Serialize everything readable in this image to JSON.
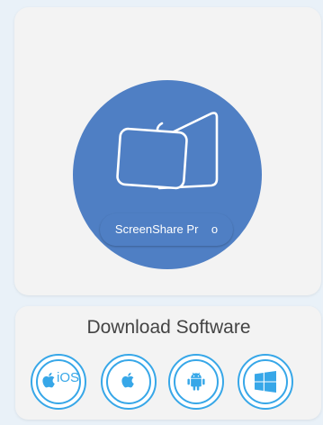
{
  "app": {
    "name": "ScreenShare Pr    o",
    "logo_icon": "screens-icon",
    "brand_color": "#4f7fc4"
  },
  "download": {
    "title": "Download Software",
    "accent_color": "#37a7e8",
    "platforms": [
      {
        "icon": "apple-icon",
        "label": "iOS"
      },
      {
        "icon": "apple-icon",
        "label": ""
      },
      {
        "icon": "android-icon",
        "label": ""
      },
      {
        "icon": "windows-icon",
        "label": ""
      }
    ]
  }
}
